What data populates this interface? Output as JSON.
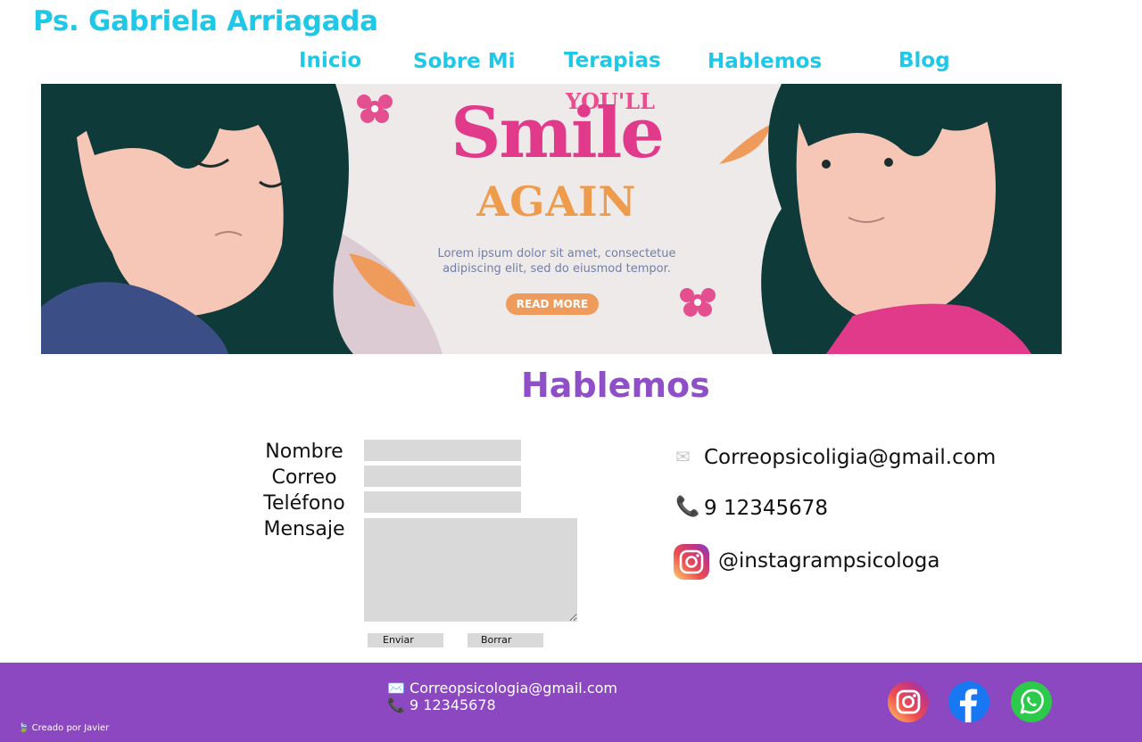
{
  "header": {
    "brand": "Ps. Gabriela Arriagada"
  },
  "nav": {
    "items": [
      {
        "label": "Inicio"
      },
      {
        "label": "Sobre Mi"
      },
      {
        "label": "Terapias"
      },
      {
        "label": "Hablemos"
      },
      {
        "label": "Blog"
      }
    ]
  },
  "banner": {
    "kicker": "YOU'LL",
    "headline": "Smile",
    "subheadline": "AGAIN",
    "body": "Lorem ipsum dolor sit amet, consectetue adipiscing elit, sed do eiusmod tempor.",
    "button": "READ MORE"
  },
  "section": {
    "title": "Hablemos"
  },
  "form": {
    "labels": {
      "name": "Nombre",
      "email": "Correo",
      "phone": "Teléfono",
      "message": "Mensaje"
    },
    "values": {
      "name": "",
      "email": "",
      "phone": "",
      "message": ""
    },
    "submit": "Enviar",
    "reset": "Borrar"
  },
  "contact": {
    "email": "Correopsicoligia@gmail.com",
    "phone": "9 12345678",
    "instagram": "@instagrampsicologa",
    "icons": [
      "envelope-icon",
      "phone-icon",
      "instagram-icon"
    ]
  },
  "footer": {
    "email": "Correopsicologia@gmail.com",
    "phone": "9 12345678",
    "credit": "Creado por Javier",
    "social": [
      "instagram-icon",
      "facebook-icon",
      "whatsapp-icon"
    ]
  },
  "colors": {
    "brand": "#1ec8e6",
    "accent": "#8e4fc7",
    "footer": "#8c48c0",
    "field": "#d9d9d9"
  }
}
